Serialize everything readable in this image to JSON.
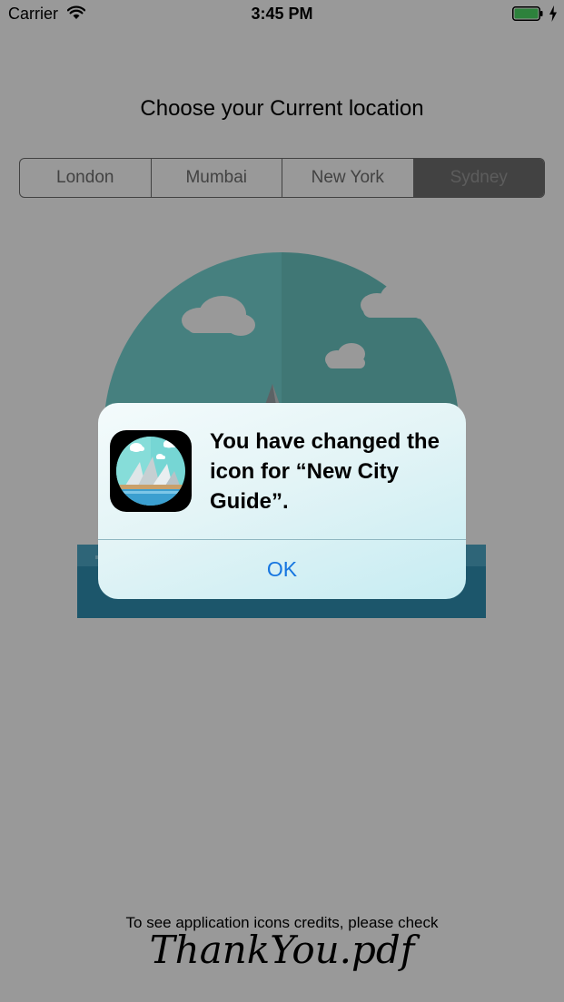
{
  "status_bar": {
    "carrier": "Carrier",
    "time": "3:45 PM",
    "battery_color": "#4cd964"
  },
  "main": {
    "title": "Choose your Current location",
    "segments": [
      {
        "label": "London",
        "selected": false
      },
      {
        "label": "Mumbai",
        "selected": false
      },
      {
        "label": "New York",
        "selected": false
      },
      {
        "label": "Sydney",
        "selected": true
      }
    ],
    "illustration": "sydney-opera-house-illustration",
    "credits_text": "To see application icons credits, please check",
    "credits_link": "ThankYou.pdf"
  },
  "alert": {
    "message": "You have changed the icon for “New City Guide”.",
    "icon": "sydney-app-icon",
    "ok_label": "OK",
    "ok_color": "#1676e0"
  }
}
